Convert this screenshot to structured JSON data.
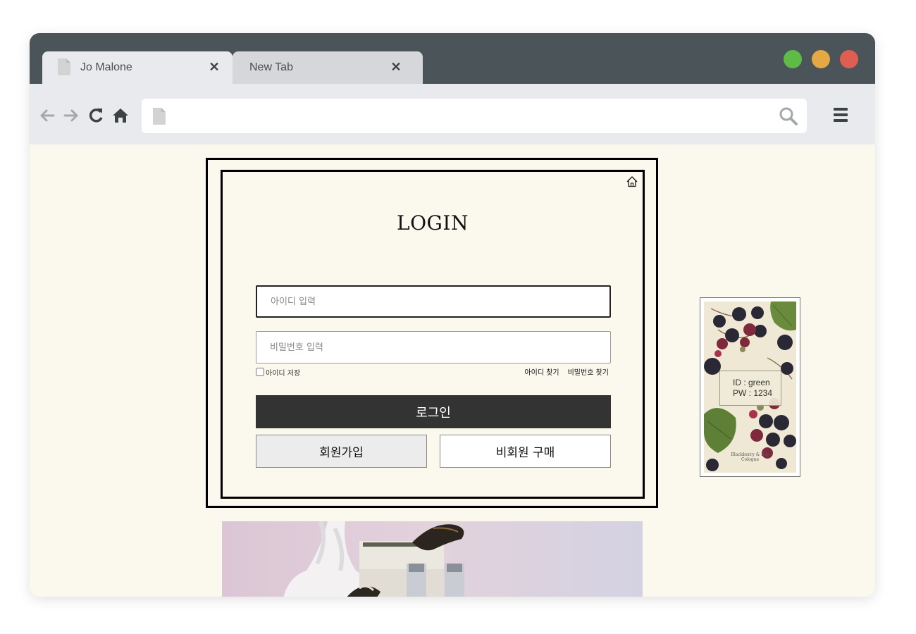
{
  "browser": {
    "tabs": [
      {
        "label": "Jo Malone",
        "active": true
      },
      {
        "label": "New Tab",
        "active": false
      }
    ],
    "url": ""
  },
  "login": {
    "title": "LOGIN",
    "id_placeholder": "아이디 입력",
    "pw_placeholder": "비밀번호 입력",
    "save_id_label": "아이디 저장",
    "find_id": "아이디 찾기",
    "find_pw": "비밀번호 찾기",
    "login_button": "로그인",
    "join_button": "회원가입",
    "guest_button": "비회원 구매"
  },
  "side_card": {
    "id_line": "ID : green",
    "pw_line": "PW : 1234",
    "caption_line1": "Blackberry & Bay",
    "caption_line2": "Cologne"
  },
  "colors": {
    "page_bg": "#fbf9ee",
    "titlebar": "#4a5459",
    "login_button": "#333333"
  }
}
